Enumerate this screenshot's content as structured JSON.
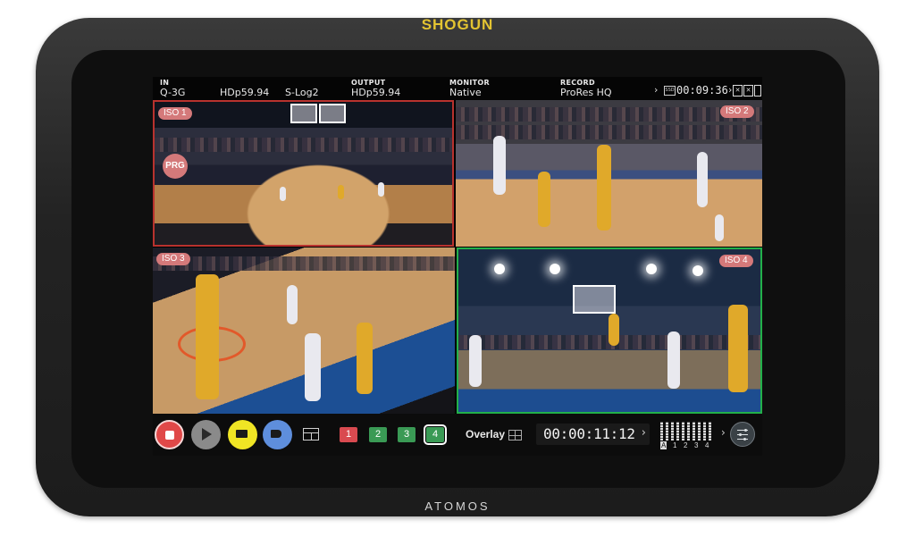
{
  "device": {
    "brand_top": "SHOGUN",
    "brand_bottom": "ATOMOS",
    "brand_top_color": "#e3c431"
  },
  "status_bar": {
    "in_label": "IN",
    "in_value": "Q-3G",
    "resolution": "HDp59.94",
    "log_format": "S-Log2",
    "output_label": "OUTPUT",
    "output_value": "HDp59.94",
    "monitor_label": "MONITOR",
    "monitor_value": "Native",
    "record_label": "RECORD",
    "record_value": "ProRes HQ",
    "ssd_label": "SSD",
    "remaining_time": "00:09:36"
  },
  "quad_view": {
    "iso_labels": [
      "ISO 1",
      "ISO 2",
      "ISO 3",
      "ISO 4"
    ],
    "program_badge": "PRG",
    "program_color": "#b8322e",
    "preview_color": "#22b04a"
  },
  "toolbar": {
    "camera_numbers": [
      "1",
      "2",
      "3",
      "4"
    ],
    "overlay_label": "Overlay",
    "timecode": "00:00:11:12",
    "audio_channels": [
      "A",
      "1",
      "2",
      "3",
      "4"
    ],
    "record_color": "#e04848",
    "cue_color": "#f0e524",
    "tag_color": "#5e8edc"
  }
}
